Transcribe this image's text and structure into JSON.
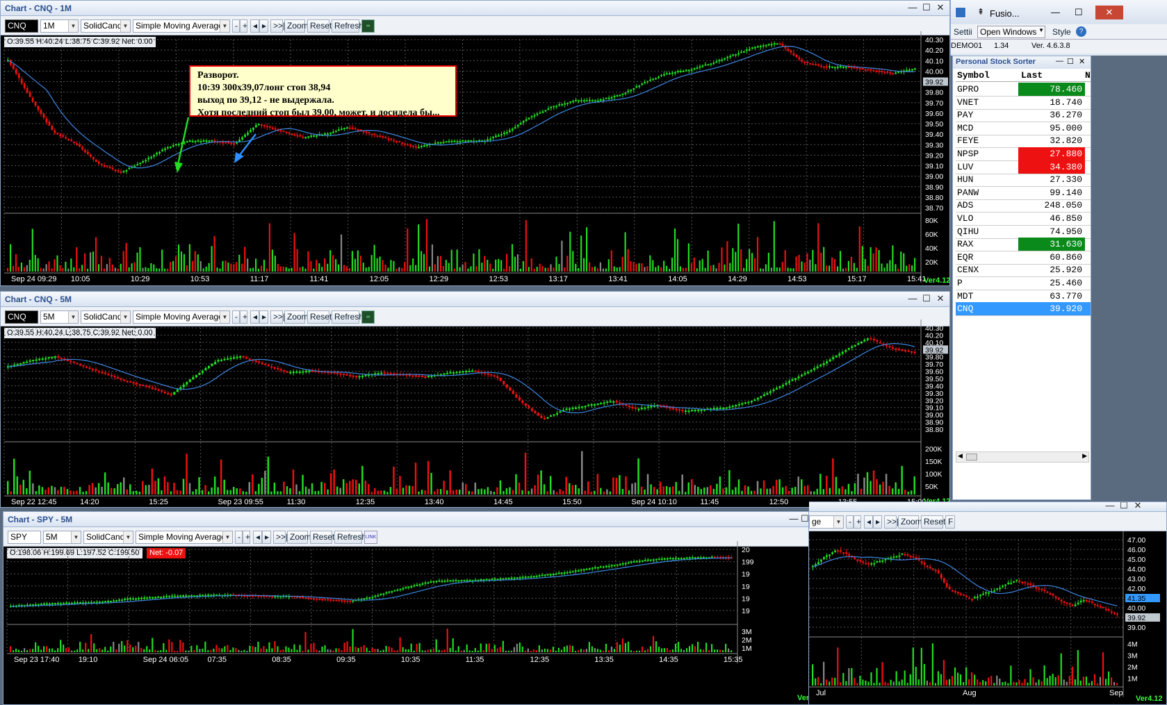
{
  "chart1": {
    "title": "Chart - CNQ - 1M",
    "symbol": "CNQ",
    "interval": "1M",
    "style": "SolidCandle",
    "indicator": "Simple Moving Average",
    "btn_minus": "-",
    "btn_plus": "+",
    "btn_prev": "◂",
    "btn_next": "▸",
    "btn_end": ">>|",
    "btn_zoom": "Zoom",
    "btn_reset": "Reset",
    "btn_refresh": "Refresh",
    "ohlc": "O:39.55  H:40.24  L:38.75  C:39.92",
    "net": "Net: 0.00",
    "price_ticks": [
      "40.30",
      "40.20",
      "40.10",
      "40.00",
      "39.92",
      "39.80",
      "39.70",
      "39.60",
      "39.50",
      "39.40",
      "39.30",
      "39.20",
      "39.10",
      "39.00",
      "38.90",
      "38.80",
      "38.70"
    ],
    "vol_ticks": [
      "80K",
      "60K",
      "40K",
      "20K"
    ],
    "time_ticks": [
      "Sep 24 09:29",
      "10:05",
      "10:29",
      "10:53",
      "11:17",
      "11:41",
      "12:05",
      "12:29",
      "12:53",
      "13:17",
      "13:41",
      "14:05",
      "14:29",
      "14:53",
      "15:17",
      "15:41"
    ],
    "last_price": "39.92",
    "version": "Ver4.12",
    "note": "Разворот.\n10:39 300x39,07лонг  стоп 38,94\nвыход по 39,12 - не выдержала.\nХотя последний стоп был 39,00, может, и досидела бы..."
  },
  "chart2": {
    "title": "Chart - CNQ - 5M",
    "symbol": "CNQ",
    "interval": "5M",
    "style": "SolidCandle",
    "indicator": "Simple Moving Average",
    "btn_minus": "-",
    "btn_plus": "+",
    "btn_prev": "◂",
    "btn_next": "▸",
    "btn_end": ">>|",
    "btn_zoom": "Zoom",
    "btn_reset": "Reset",
    "btn_refresh": "Refresh",
    "ohlc": "O:39.55  H:40.24  L:38.75  C:39.92",
    "net": "Net: 0.00",
    "price_ticks": [
      "40.30",
      "40.20",
      "40.10",
      "39.92",
      "39.80",
      "39.70",
      "39.60",
      "39.50",
      "39.40",
      "39.30",
      "39.20",
      "39.10",
      "39.00",
      "38.90",
      "38.80"
    ],
    "vol_ticks": [
      "200K",
      "150K",
      "100K",
      "50K"
    ],
    "time_ticks": [
      "Sep 22 12:45",
      "14:20",
      "15:25",
      "Sep 23 09:55",
      "11:30",
      "12:35",
      "13:40",
      "14:45",
      "15:50",
      "Sep 24 10:10",
      "11:45",
      "12:50",
      "13:55",
      "15:00"
    ],
    "last_price": "39.92",
    "version": "Ver4.12"
  },
  "chart3": {
    "title": "Chart - SPY - 5M",
    "symbol": "SPY",
    "interval": "5M",
    "style": "SolidCandle",
    "indicator": "Simple Moving Average",
    "btn_minus": "-",
    "btn_plus": "+",
    "btn_prev": "◂",
    "btn_next": "▸",
    "btn_end": ">>|",
    "btn_zoom": "Zoom",
    "btn_reset": "Reset",
    "btn_refresh": "Refresh",
    "ohlc": "O:198.06  H:199.69  L:197.52  C:199.50",
    "net": "Net: -0.07",
    "price_ticks": [
      "20",
      "199",
      "19",
      "19",
      "19",
      "19"
    ],
    "vol_ticks": [
      "3M",
      "2M",
      "1M"
    ],
    "time_ticks": [
      "Sep 23 17:40",
      "19:10",
      "Sep 24 06:05",
      "07:35",
      "08:35",
      "09:35",
      "10:35",
      "11:35",
      "12:35",
      "13:35",
      "14:35",
      "15:35"
    ],
    "version": "Ver"
  },
  "chart4": {
    "indicator": "ge",
    "btn_minus": "-",
    "btn_plus": "+",
    "btn_prev": "◂",
    "btn_next": "▸",
    "btn_end": ">>|",
    "btn_zoom": "Zoom",
    "btn_reset": "Reset",
    "btn_f": "F",
    "price_ticks": [
      "47.00",
      "46.00",
      "45.00",
      "44.00",
      "43.00",
      "42.00",
      "41.35",
      "40.00",
      "39.92",
      "39.00"
    ],
    "vol_ticks": [
      "4M",
      "3M",
      "2M",
      "1M"
    ],
    "time_ticks": [
      "Jul",
      "Aug",
      "Sep"
    ],
    "version": "Ver4.12"
  },
  "fusion": {
    "title": "Fusio...",
    "menu_settings": "Settii",
    "menu_open_windows": "Open Windows",
    "menu_style": "Style",
    "account": "DEMO01",
    "value": "1.34",
    "version": "Ver. 4.6.3.8"
  },
  "sorter": {
    "title": "Personal Stock Sorter",
    "col_symbol": "Symbol",
    "col_last": "Last",
    "col_extra": "N",
    "rows": [
      {
        "symbol": "GPRO",
        "last": "78.460",
        "bg": "#0a8a1a",
        "fg": "#ffffff"
      },
      {
        "symbol": "VNET",
        "last": "18.740",
        "bg": "",
        "fg": "#000000"
      },
      {
        "symbol": "PAY",
        "last": "36.270",
        "bg": "",
        "fg": "#000000"
      },
      {
        "symbol": "MCD",
        "last": "95.000",
        "bg": "",
        "fg": "#000000"
      },
      {
        "symbol": "FEYE",
        "last": "32.820",
        "bg": "",
        "fg": "#000000"
      },
      {
        "symbol": "NPSP",
        "last": "27.880",
        "bg": "#ee1111",
        "fg": "#ffffff"
      },
      {
        "symbol": "LUV",
        "last": "34.380",
        "bg": "#ee1111",
        "fg": "#ffffff"
      },
      {
        "symbol": "HUN",
        "last": "27.330",
        "bg": "",
        "fg": "#000000"
      },
      {
        "symbol": "PANW",
        "last": "99.140",
        "bg": "",
        "fg": "#000000"
      },
      {
        "symbol": "ADS",
        "last": "248.050",
        "bg": "",
        "fg": "#000000"
      },
      {
        "symbol": "VLO",
        "last": "46.850",
        "bg": "",
        "fg": "#000000"
      },
      {
        "symbol": "QIHU",
        "last": "74.950",
        "bg": "",
        "fg": "#000000"
      },
      {
        "symbol": "RAX",
        "last": "31.630",
        "bg": "#0a8a1a",
        "fg": "#ffffff"
      },
      {
        "symbol": "EQR",
        "last": "60.860",
        "bg": "",
        "fg": "#000000"
      },
      {
        "symbol": "CENX",
        "last": "25.920",
        "bg": "",
        "fg": "#000000"
      },
      {
        "symbol": "P",
        "last": "25.460",
        "bg": "",
        "fg": "#000000"
      },
      {
        "symbol": "MDT",
        "last": "63.770",
        "bg": "",
        "fg": "#000000"
      },
      {
        "symbol": "CNQ",
        "last": "39.920",
        "bg": "#3399ff",
        "fg": "#ffffff",
        "selected": true
      }
    ]
  },
  "colors": {
    "up": "#22dd22",
    "down": "#ee1111",
    "sma": "#3a7fd6",
    "grid": "#555555",
    "axis_text": "#ffffff",
    "last_tag": "#c0c8d0",
    "sel_tag": "#3399ff"
  }
}
